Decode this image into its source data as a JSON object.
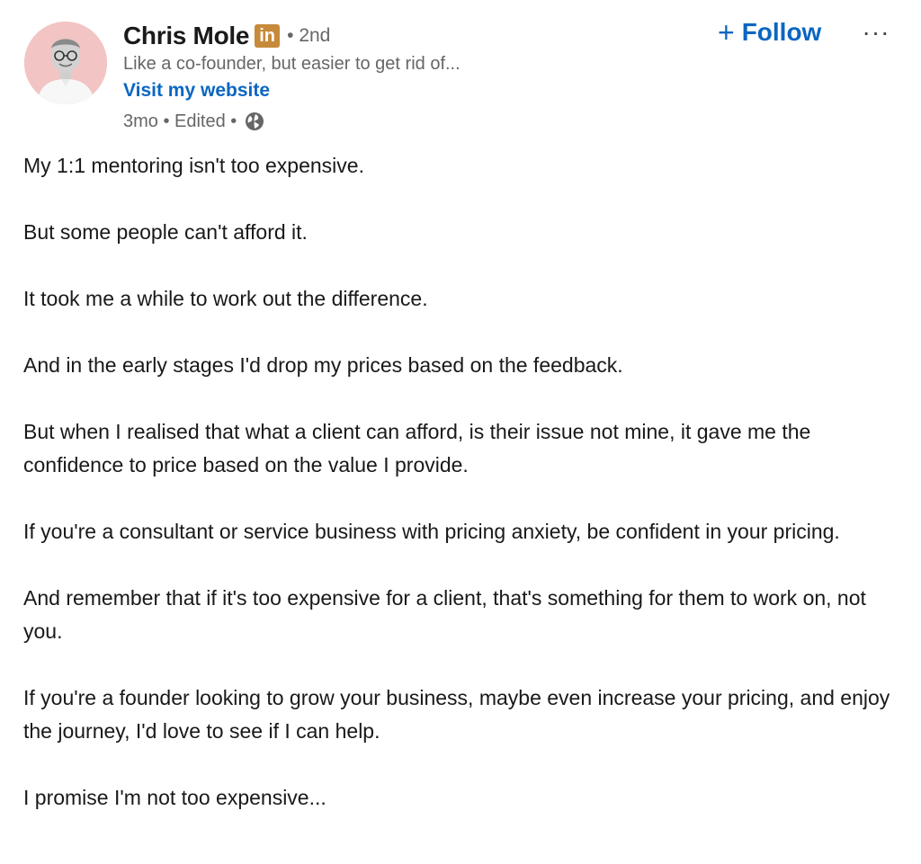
{
  "author": {
    "name": "Chris Mole",
    "badge": "in",
    "degree": "• 2nd",
    "headline": "Like a co-founder, but easier to get rid of...",
    "website_link": "Visit my website",
    "meta": "3mo • Edited •",
    "visibility_icon": "globe-icon",
    "avatar_bg": "#f2c4c4"
  },
  "actions": {
    "follow_label": "Follow",
    "follow_icon": "+",
    "more_icon": "···",
    "accent_color": "#0a66c2"
  },
  "post": {
    "paragraphs": [
      "My 1:1 mentoring isn't too expensive.",
      "But some people can't afford it.",
      "It took me a while to work out the difference.",
      "And in the early stages I'd drop my prices based on the feedback.",
      "But when I realised that what a client can afford, is their issue not mine, it gave me the confidence to price based on the value I provide.",
      "If you're a consultant or service business with pricing anxiety, be confident in your pricing.",
      "And remember that if it's too expensive for a client, that's something for them to work on, not you.",
      "If you're a founder looking to grow your business, maybe even increase your pricing, and enjoy the journey, I'd love to see if I can help.",
      "I promise I'm not too expensive..."
    ]
  }
}
